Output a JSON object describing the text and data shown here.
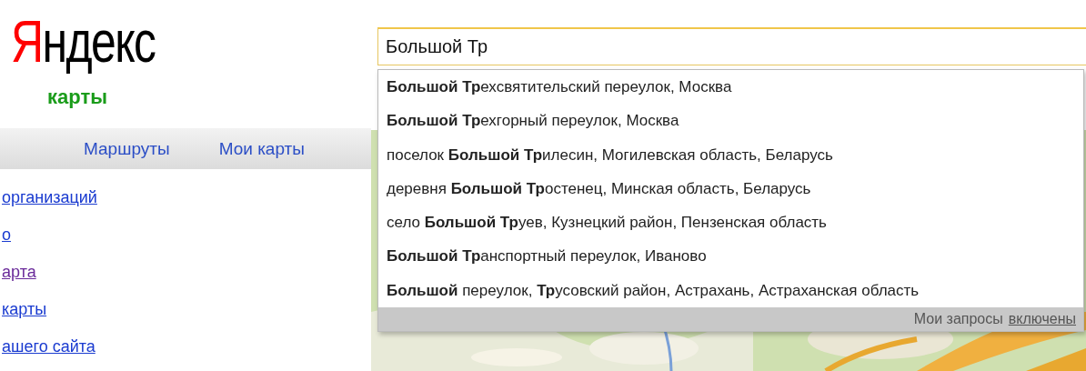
{
  "logo": {
    "text": "Яндекс",
    "service": "карты"
  },
  "nav": [
    {
      "label": "Маршруты"
    },
    {
      "label": "Мои карты"
    }
  ],
  "side_links": [
    {
      "label": "организаций",
      "visited": false
    },
    {
      "label": "о",
      "visited": false
    },
    {
      "label": "арта",
      "visited": true
    },
    {
      "label": "карты",
      "visited": false
    },
    {
      "label": "ашего сайта",
      "visited": false
    }
  ],
  "search": {
    "value": "Большой Тр"
  },
  "suggestions": [
    {
      "text": "**Большой Тр**ехсвятительский переулок, Москва"
    },
    {
      "text": "**Большой Тр**ехгорный переулок, Москва"
    },
    {
      "text": "поселок **Большой Тр**илесин, Могилевская область, Беларусь"
    },
    {
      "text": "деревня **Большой Тр**остенец, Минская область, Беларусь"
    },
    {
      "text": "село **Большой Тр**уев, Кузнецкий район, Пензенская область"
    },
    {
      "text": "**Большой Тр**анспортный переулок, Иваново"
    },
    {
      "text": "**Большой** переулок, **Тр**усовский район, Астрахань, Астраханская область"
    }
  ],
  "suggest_footer": {
    "label": "Мои запросы",
    "link": "включены"
  }
}
